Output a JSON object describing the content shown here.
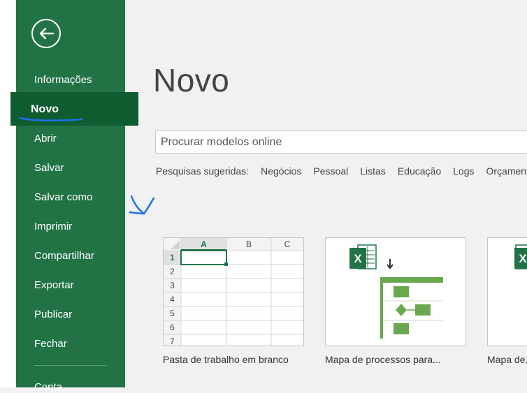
{
  "sidebar": {
    "items": [
      {
        "label": "Informações"
      },
      {
        "label": "Novo"
      },
      {
        "label": "Abrir"
      },
      {
        "label": "Salvar"
      },
      {
        "label": "Salvar como"
      },
      {
        "label": "Imprimir"
      },
      {
        "label": "Compartilhar"
      },
      {
        "label": "Exportar"
      },
      {
        "label": "Publicar"
      },
      {
        "label": "Fechar"
      }
    ],
    "account_label": "Conta",
    "selected": "Novo"
  },
  "main": {
    "title": "Novo",
    "search_placeholder": "Procurar modelos online",
    "suggest_label": "Pesquisas sugeridas:",
    "suggestions": [
      "Negócios",
      "Pessoal",
      "Listas",
      "Educação",
      "Logs",
      "Orçamentos"
    ],
    "templates": [
      {
        "label": "Pasta de trabalho em branco"
      },
      {
        "label": "Mapa de processos para..."
      },
      {
        "label": "Mapa de..."
      }
    ],
    "grid": {
      "columns": [
        "A",
        "B",
        "C"
      ],
      "rows": [
        "1",
        "2",
        "3",
        "4",
        "5",
        "6",
        "7"
      ]
    }
  },
  "colors": {
    "sidebar": "#217346",
    "selected": "#0e5c2f",
    "annotation": "#1a73e8"
  }
}
